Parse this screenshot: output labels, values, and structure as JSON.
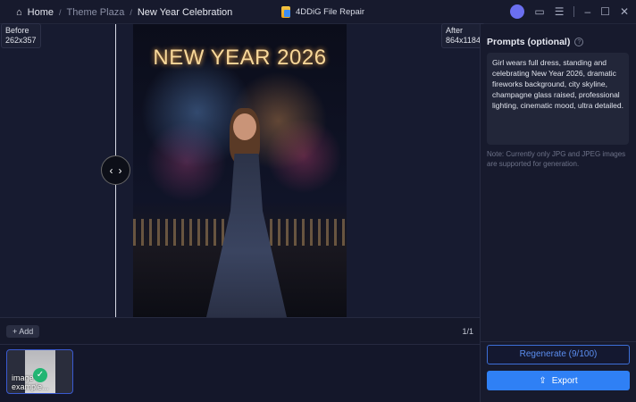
{
  "breadcrumb": {
    "home": "Home",
    "sep": "/",
    "theme": "Theme Plaza",
    "current": "New Year Celebration"
  },
  "app_title": "4DDiG File Repair",
  "window": {
    "menu_icon": "☰",
    "min": "–",
    "max": "☐",
    "close": "✕",
    "feedback": "▭"
  },
  "compare": {
    "before_label": "Before",
    "before_size": "262x357",
    "after_label": "After",
    "after_size": "864x1184",
    "handle_left": "‹",
    "handle_right": "›",
    "image_text": "NEW YEAR 2026"
  },
  "add_label": "+ Add",
  "page_count": "1/1",
  "thumbnails": [
    {
      "label": "image example...",
      "check": "✓"
    }
  ],
  "panel": {
    "title": "Prompts (optional)",
    "help": "?",
    "prompt": "Girl wears full dress, standing and celebrating New Year 2026, dramatic fireworks background, city skyline, champagne glass raised, professional lighting, cinematic mood, ultra detailed.",
    "note": "Note: Currently only JPG and JPEG images are supported for generation.",
    "regenerate": "Regenerate (9/100)",
    "export": "Export",
    "export_icon": "⇪"
  },
  "colors": {
    "accent": "#2f80f5",
    "bg": "#14172a",
    "success": "#22b573"
  }
}
